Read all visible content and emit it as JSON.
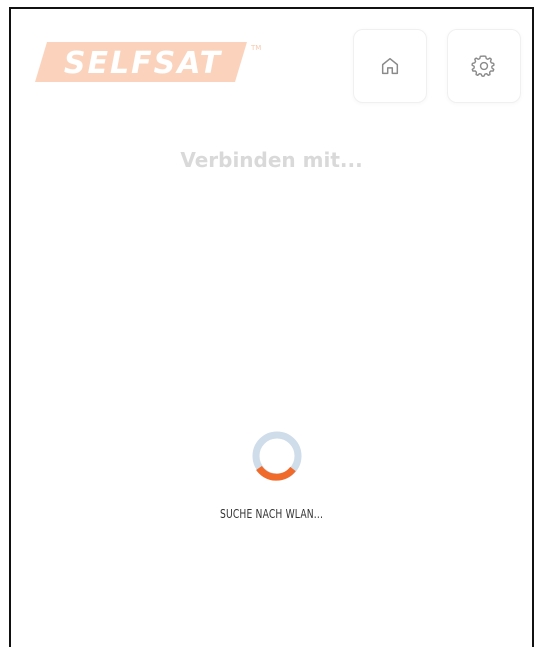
{
  "header": {
    "logo_text": "SELFSAT",
    "logo_tm": "TM",
    "home_icon": "home-icon",
    "settings_icon": "gear-icon"
  },
  "main": {
    "title": "Verbinden mit...",
    "status": "SUCHE NACH WLAN..."
  },
  "colors": {
    "brand": "#f06a2a",
    "brand_faded": "#fbd3bd",
    "spinner_track": "#cfdcea",
    "spinner_arc": "#f06a2a",
    "title": "#d9d9d9"
  }
}
